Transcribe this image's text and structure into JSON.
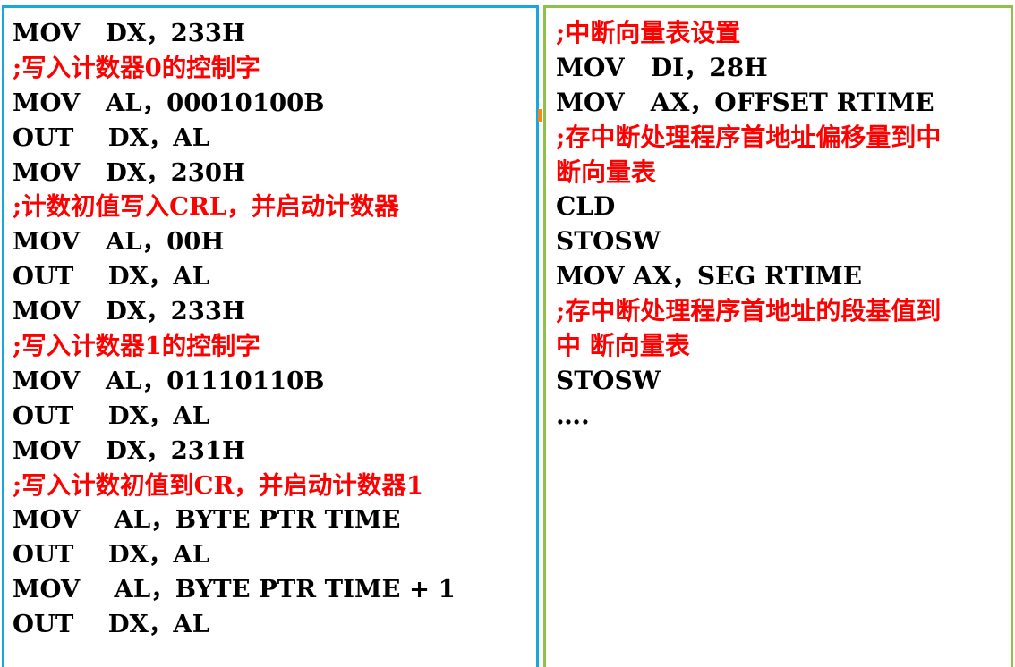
{
  "left_panel": {
    "lines": [
      {
        "text": "MOV   DX，233H",
        "kind": "code"
      },
      {
        "text": ";写入计数器0的控制字",
        "kind": "comment"
      },
      {
        "text": "MOV   AL，00010100B",
        "kind": "code"
      },
      {
        "text": "OUT    DX，AL",
        "kind": "code"
      },
      {
        "text": "MOV   DX，230H",
        "kind": "code"
      },
      {
        "text": ";计数初值写入CRL，并启动计数器",
        "kind": "comment"
      },
      {
        "text": "MOV   AL，00H",
        "kind": "code"
      },
      {
        "text": "OUT    DX，AL",
        "kind": "code"
      },
      {
        "text": "MOV   DX，233H",
        "kind": "code"
      },
      {
        "text": ";写入计数器1的控制字",
        "kind": "comment"
      },
      {
        "text": "MOV   AL，01110110B",
        "kind": "code"
      },
      {
        "text": "OUT    DX，AL",
        "kind": "code"
      },
      {
        "text": "MOV   DX，231H",
        "kind": "code"
      },
      {
        "text": ";写入计数初值到CR，并启动计数器1",
        "kind": "comment"
      },
      {
        "text": "MOV    AL，BYTE PTR TIME",
        "kind": "code"
      },
      {
        "text": "OUT    DX，AL",
        "kind": "code"
      },
      {
        "text": "MOV    AL，BYTE PTR TIME + 1",
        "kind": "code"
      },
      {
        "text": "OUT    DX，AL",
        "kind": "code"
      }
    ]
  },
  "right_panel": {
    "lines": [
      {
        "text": ";中断向量表设置",
        "kind": "comment"
      },
      {
        "text": "MOV   DI，28H",
        "kind": "code"
      },
      {
        "text": "MOV   AX，OFFSET RTIME",
        "kind": "code"
      },
      {
        "text": ";存中断处理程序首地址偏移量到中",
        "kind": "comment"
      },
      {
        "text": "断向量表",
        "kind": "comment"
      },
      {
        "text": "CLD",
        "kind": "code"
      },
      {
        "text": "STOSW",
        "kind": "code"
      },
      {
        "text": "MOV AX，SEG RTIME",
        "kind": "code"
      },
      {
        "text": ";存中断处理程序首地址的段基值到",
        "kind": "comment"
      },
      {
        "text": "中 断向量表",
        "kind": "comment"
      },
      {
        "text": "STOSW",
        "kind": "code"
      },
      {
        "text": "….",
        "kind": "code"
      }
    ]
  },
  "colors": {
    "code_text": "#000000",
    "comment_text": "#ff0000",
    "left_border": "#1aa7dc",
    "right_border": "#8ec34a",
    "divider_mark": "#f08a1e"
  }
}
